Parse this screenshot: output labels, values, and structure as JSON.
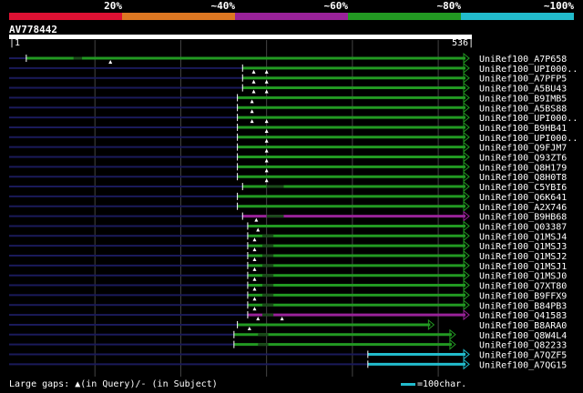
{
  "identity_legend": {
    "labels": [
      "20%",
      "~40%",
      "~60%",
      "~80%",
      "~100%"
    ],
    "colors": [
      "#dd1133",
      "#dd7722",
      "#992299",
      "#229922",
      "#22bbcc"
    ]
  },
  "query": {
    "name": "AV778442",
    "start_label": "1",
    "end_label": "536",
    "length": 536
  },
  "hits": [
    {
      "name": "UniRef100_A7P658",
      "color": "#229922",
      "start": 20,
      "end": 536,
      "gaps": [
        [
          75,
          85
        ]
      ],
      "marks": [
        118
      ]
    },
    {
      "name": "UniRef100_UPI000..",
      "color": "#229922",
      "start": 272,
      "end": 536,
      "gaps": [],
      "marks": [
        285,
        300
      ]
    },
    {
      "name": "UniRef100_A7PFP5",
      "color": "#229922",
      "start": 272,
      "end": 536,
      "gaps": [],
      "marks": [
        285,
        300
      ]
    },
    {
      "name": "UniRef100_A5BU43",
      "color": "#229922",
      "start": 272,
      "end": 536,
      "gaps": [],
      "marks": [
        285,
        300
      ]
    },
    {
      "name": "UniRef100_B9IMB5",
      "color": "#229922",
      "start": 266,
      "end": 536,
      "gaps": [],
      "marks": [
        283
      ]
    },
    {
      "name": "UniRef100_A5BS88",
      "color": "#229922",
      "start": 266,
      "end": 536,
      "gaps": [],
      "marks": [
        283
      ]
    },
    {
      "name": "UniRef100_UPI000..",
      "color": "#229922",
      "start": 266,
      "end": 536,
      "gaps": [],
      "marks": [
        283,
        300
      ]
    },
    {
      "name": "UniRef100_B9HB41",
      "color": "#229922",
      "start": 266,
      "end": 536,
      "gaps": [],
      "marks": [
        300
      ]
    },
    {
      "name": "UniRef100_UPI000..",
      "color": "#229922",
      "start": 266,
      "end": 536,
      "gaps": [],
      "marks": [
        300
      ]
    },
    {
      "name": "UniRef100_Q9FJM7",
      "color": "#229922",
      "start": 266,
      "end": 536,
      "gaps": [],
      "marks": [
        300
      ]
    },
    {
      "name": "UniRef100_Q93ZT6",
      "color": "#229922",
      "start": 266,
      "end": 536,
      "gaps": [],
      "marks": [
        300
      ]
    },
    {
      "name": "UniRef100_Q8H179",
      "color": "#229922",
      "start": 266,
      "end": 536,
      "gaps": [],
      "marks": [
        300
      ]
    },
    {
      "name": "UniRef100_Q8H0T8",
      "color": "#229922",
      "start": 266,
      "end": 536,
      "gaps": [],
      "marks": [
        300
      ]
    },
    {
      "name": "UniRef100_C5YBI6",
      "color": "#229922",
      "start": 272,
      "end": 536,
      "gaps": [
        [
          300,
          320
        ]
      ],
      "marks": []
    },
    {
      "name": "UniRef100_Q6K641",
      "color": "#229922",
      "start": 266,
      "end": 536,
      "gaps": [],
      "marks": []
    },
    {
      "name": "UniRef100_A2X746",
      "color": "#229922",
      "start": 266,
      "end": 536,
      "gaps": [],
      "marks": []
    },
    {
      "name": "UniRef100_B9HB68",
      "color": "#992299",
      "start": 272,
      "end": 536,
      "gaps": [
        [
          300,
          320
        ]
      ],
      "marks": [
        288
      ]
    },
    {
      "name": "UniRef100_Q03387",
      "color": "#229922",
      "start": 278,
      "end": 536,
      "gaps": [],
      "marks": [
        290
      ]
    },
    {
      "name": "UniRef100_Q1MSJ4",
      "color": "#229922",
      "start": 278,
      "end": 536,
      "gaps": [
        [
          295,
          308
        ]
      ],
      "marks": [
        286
      ]
    },
    {
      "name": "UniRef100_Q1MSJ3",
      "color": "#229922",
      "start": 278,
      "end": 536,
      "gaps": [
        [
          295,
          308
        ]
      ],
      "marks": [
        286
      ]
    },
    {
      "name": "UniRef100_Q1MSJ2",
      "color": "#229922",
      "start": 278,
      "end": 536,
      "gaps": [
        [
          295,
          308
        ]
      ],
      "marks": [
        286
      ]
    },
    {
      "name": "UniRef100_Q1MSJ1",
      "color": "#229922",
      "start": 278,
      "end": 536,
      "gaps": [
        [
          295,
          308
        ]
      ],
      "marks": [
        286
      ]
    },
    {
      "name": "UniRef100_Q1MSJ0",
      "color": "#229922",
      "start": 278,
      "end": 536,
      "gaps": [
        [
          295,
          308
        ]
      ],
      "marks": [
        286
      ]
    },
    {
      "name": "UniRef100_Q7XT80",
      "color": "#229922",
      "start": 278,
      "end": 536,
      "gaps": [
        [
          295,
          308
        ]
      ],
      "marks": [
        286
      ]
    },
    {
      "name": "UniRef100_B9FFX9",
      "color": "#229922",
      "start": 278,
      "end": 536,
      "gaps": [
        [
          295,
          308
        ]
      ],
      "marks": [
        286
      ]
    },
    {
      "name": "UniRef100_B84PB3",
      "color": "#229922",
      "start": 278,
      "end": 536,
      "gaps": [
        [
          295,
          308
        ]
      ],
      "marks": [
        286
      ]
    },
    {
      "name": "UniRef100_Q41583",
      "color": "#992299",
      "start": 278,
      "end": 536,
      "gaps": [
        [
          295,
          308
        ]
      ],
      "marks": [
        290,
        318
      ]
    },
    {
      "name": "UniRef100_B8ARA0",
      "color": "#229922",
      "start": 266,
      "end": 495,
      "gaps": [],
      "marks": [
        280
      ]
    },
    {
      "name": "UniRef100_Q8W4L4",
      "color": "#229922",
      "start": 262,
      "end": 520,
      "gaps": [
        [
          290,
          302
        ]
      ],
      "marks": []
    },
    {
      "name": "UniRef100_Q82233",
      "color": "#229922",
      "start": 262,
      "end": 520,
      "gaps": [
        [
          290,
          302
        ]
      ],
      "marks": []
    },
    {
      "name": "UniRef100_A7QZF5",
      "color": "#22bbcc",
      "start": 418,
      "end": 536,
      "gaps": [],
      "marks": []
    },
    {
      "name": "UniRef100_A7QG15",
      "color": "#22bbcc",
      "start": 418,
      "end": 536,
      "gaps": [],
      "marks": []
    }
  ],
  "footer": {
    "gap_text": "Large gaps: ▲(in Query)/- (in Subject)",
    "scale_text": "=100char."
  }
}
